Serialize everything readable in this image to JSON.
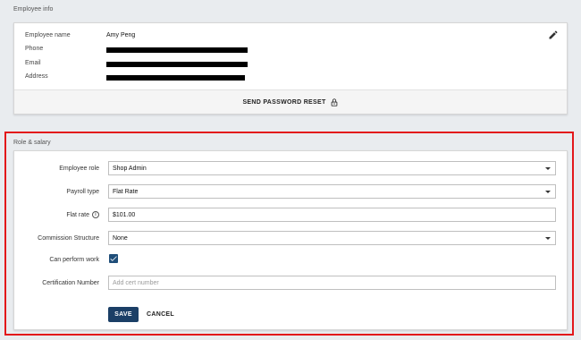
{
  "employee_info": {
    "section_title": "Employee info",
    "fields": [
      {
        "label": "Employee name",
        "value": "Amy Peng"
      },
      {
        "label": "Phone",
        "value": ""
      },
      {
        "label": "Email",
        "value": ""
      },
      {
        "label": "Address",
        "value": ""
      }
    ],
    "reset_label": "SEND PASSWORD RESET",
    "edit_icon": "pencil-icon",
    "reset_icon": "lock-icon"
  },
  "role_salary": {
    "section_title": "Role & salary",
    "employee_role": {
      "label": "Employee role",
      "value": "Shop Admin"
    },
    "payroll_type": {
      "label": "Payroll type",
      "value": "Flat Rate"
    },
    "flat_rate": {
      "label": "Flat rate",
      "value": "$101.00",
      "icon": "info-icon"
    },
    "commission": {
      "label": "Commission Structure",
      "value": "None"
    },
    "can_perform_work": {
      "label": "Can perform work",
      "checked": true
    },
    "certification": {
      "label": "Certification Number",
      "placeholder": "Add cert number",
      "value": ""
    },
    "save_label": "SAVE",
    "cancel_label": "CANCEL"
  },
  "colors": {
    "highlight": "#e3181b",
    "primary": "#1b3f66",
    "background": "#e9ecef"
  }
}
